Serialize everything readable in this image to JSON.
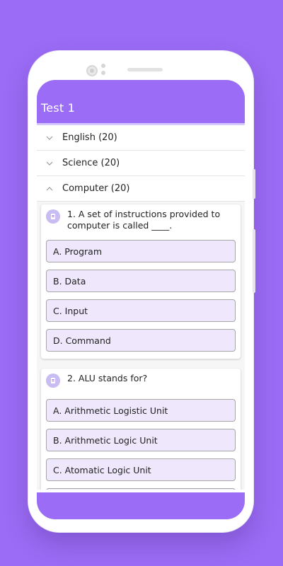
{
  "app": {
    "title": "Test 1"
  },
  "subjects": [
    {
      "label": "English (20)",
      "expanded": false
    },
    {
      "label": "Science (20)",
      "expanded": false
    },
    {
      "label": "Computer (20)",
      "expanded": true
    }
  ],
  "questions": [
    {
      "text": "1. A set of instructions provided to computer is called ____.",
      "options": [
        "A. Program",
        "B. Data",
        "C. Input",
        "D. Command"
      ]
    },
    {
      "text": "2. ALU stands for?",
      "options": [
        "A. Arithmetic Logistic Unit",
        "B. Arithmetic Logic Unit",
        "C. Atomatic Logic Unit"
      ]
    }
  ],
  "colors": {
    "accent": "#9b6cf5",
    "option_bg": "#efe8fd",
    "icon_bg": "#c8bcf3"
  },
  "icons": {
    "collapsed": "chevron-down-icon",
    "expanded": "chevron-up-icon",
    "question": "question-icon"
  }
}
